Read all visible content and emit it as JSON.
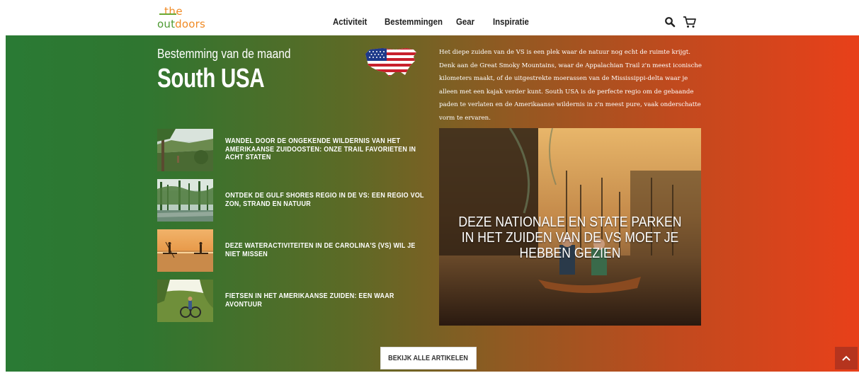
{
  "header": {
    "logo_the": "the",
    "logo_out": "out",
    "logo_doors": "doors",
    "nav": [
      "Activiteit",
      "Bestemmingen",
      "Gear",
      "Inspiratie"
    ]
  },
  "hero": {
    "kicker": "Bestemming van de maand",
    "title": "South USA",
    "intro": "Het diepe zuiden van de VS is een plek waar de natuur nog echt de ruimte krijgt. Denk aan de Great Smoky Mountains, waar de Appalachian Trail z'n meest iconische kilometers maakt, of de uitgestrekte moerassen van de Mississippi-delta waar je alleen met een kajak verder kunt. South USA is de perfecte regio om de gebaande paden te verlaten en de Amerikaanse wildernis in z'n meest pure, vaak onderschatte vorm te ervaren."
  },
  "articles": [
    {
      "title": "Wandel door de ongekende wildernis van het Amerikaanse zuidoosten: onze trail favorieten in acht staten"
    },
    {
      "title": "Ontdek de Gulf Shores regio in de VS: een regio vol zon, strand en natuur"
    },
    {
      "title": "Deze wateractiviteiten in de Carolina's (VS) wil je niet missen"
    },
    {
      "title": "Fietsen in het Amerikaanse zuiden: een waar avontuur"
    }
  ],
  "featured": {
    "title": "DEZE NATIONALE EN STATE PARKEN IN HET ZUIDEN VAN DE VS MOET JE HEBBEN GEZIEN"
  },
  "cta_label": "BEKIJK ALLE ARTIKELEN",
  "colors": {
    "gradient_start": "#2a7a34",
    "gradient_end": "#e8401a",
    "logo_green": "#4e9a32",
    "logo_orange": "#f08a24"
  }
}
